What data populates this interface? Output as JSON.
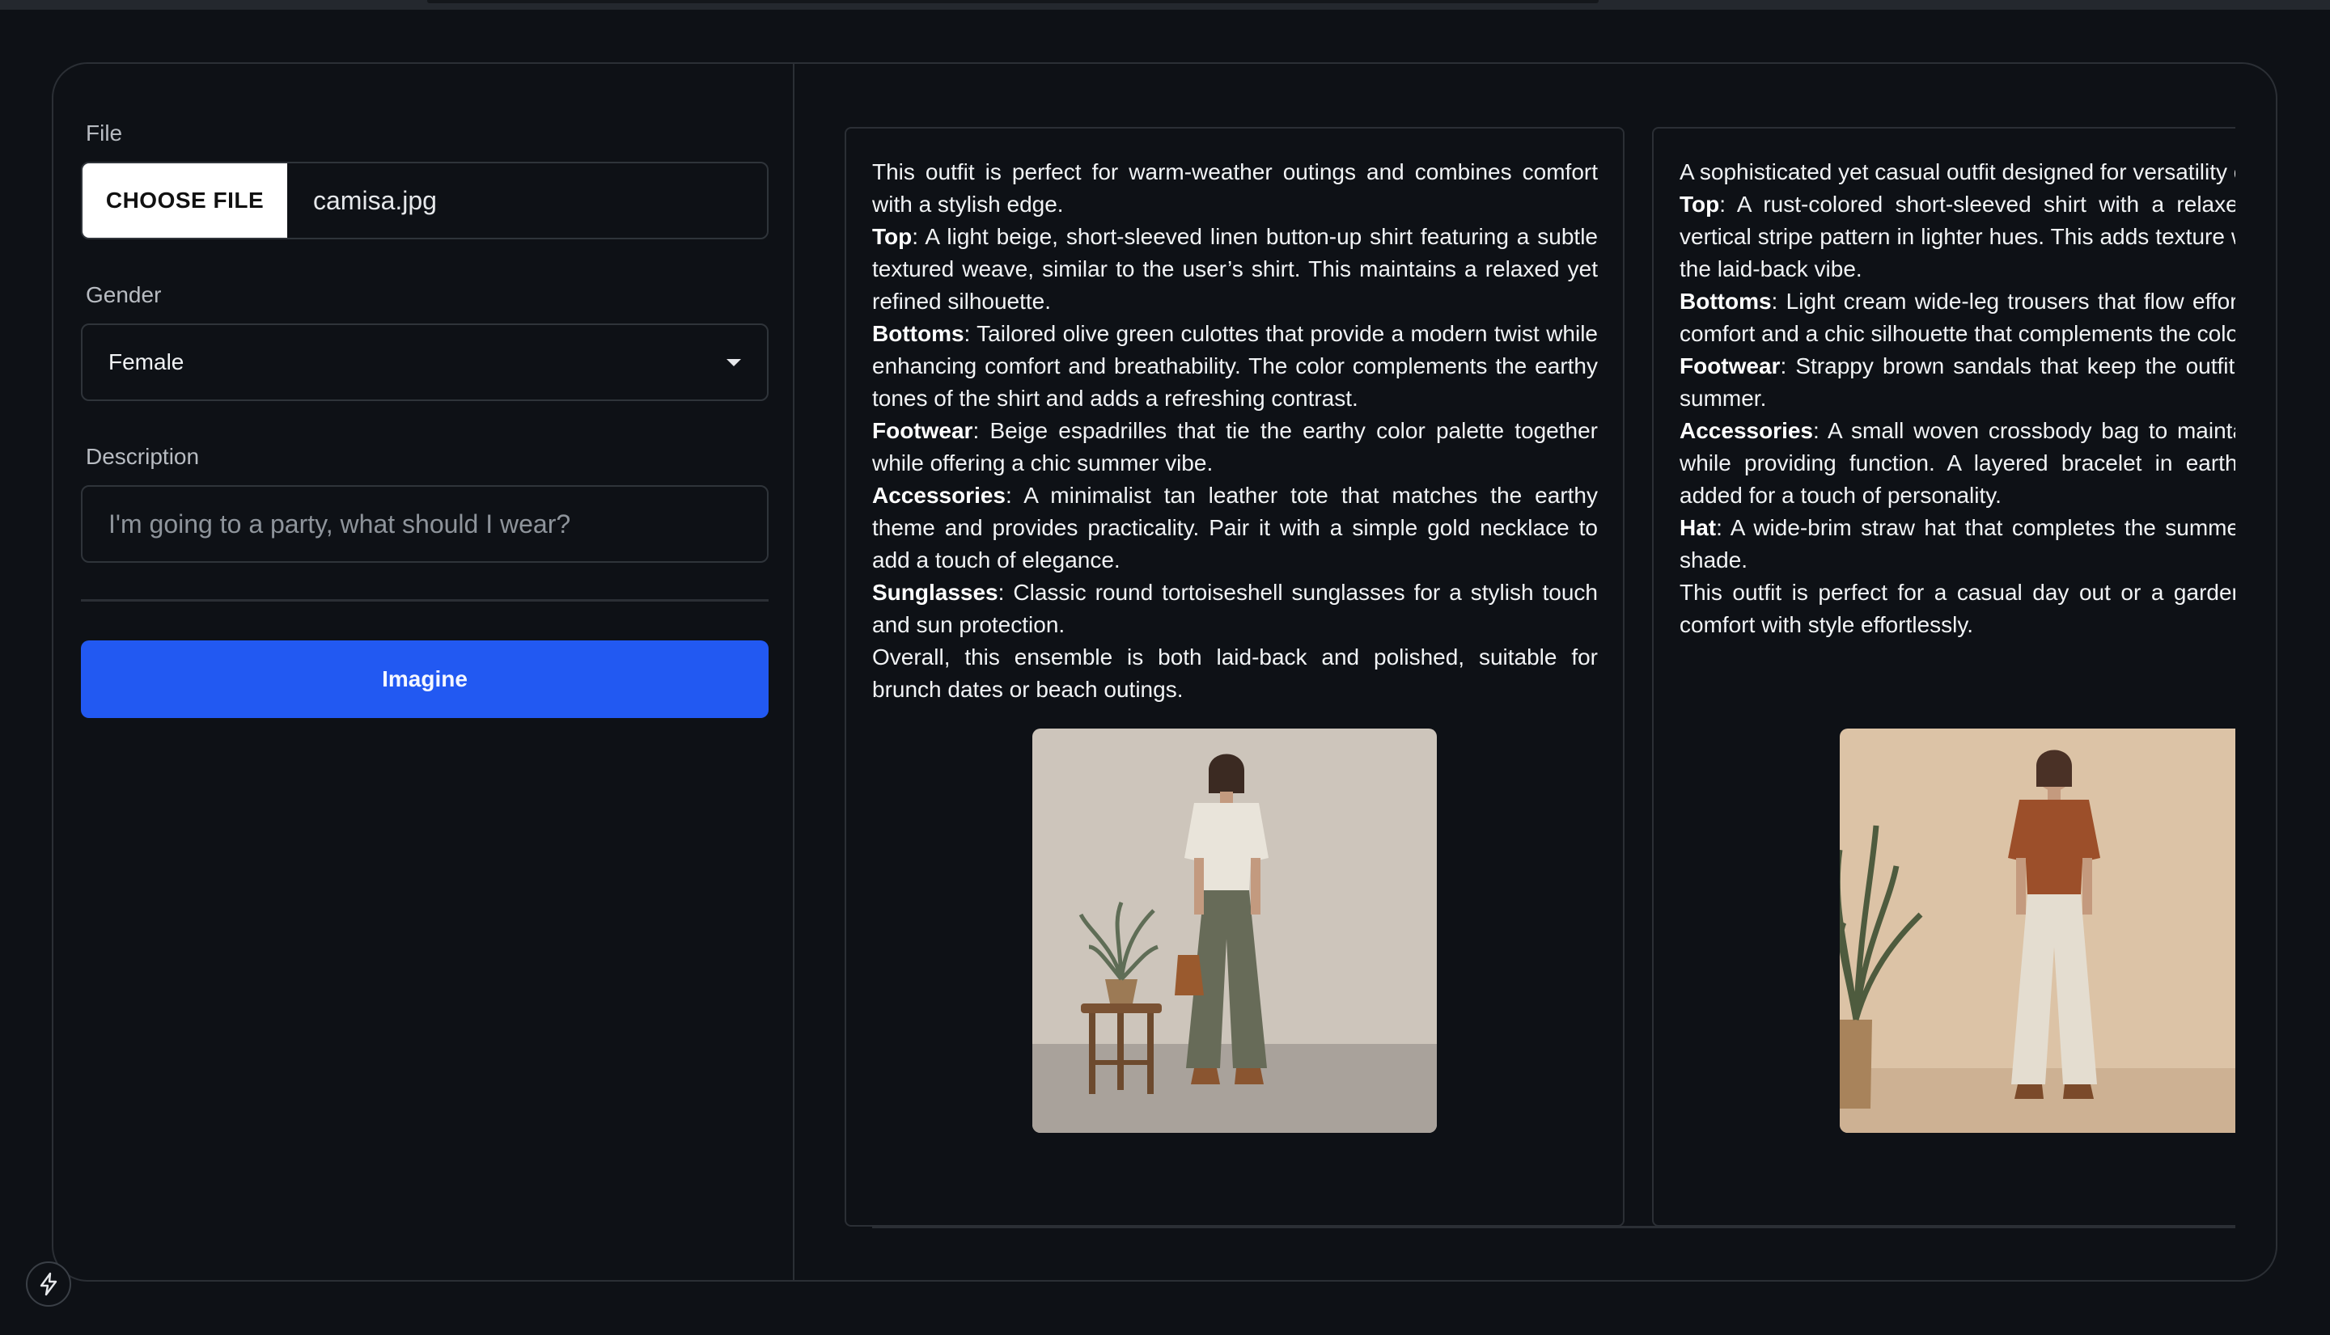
{
  "form": {
    "file_label": "File",
    "choose_file_label": "CHOOSE FILE",
    "file_name": "camisa.jpg",
    "gender_label": "Gender",
    "gender_value": "Female",
    "description_label": "Description",
    "description_placeholder": "I'm going to a party, what should I wear?",
    "submit_label": "Imagine"
  },
  "results": [
    {
      "intro": "This outfit is perfect for warm-weather outings and combines comfort with a stylish edge.",
      "items": [
        {
          "label": "Top",
          "text": ": A light beige, short-sleeved linen button-up shirt featuring a subtle textured weave, similar to the user’s shirt. This maintains a relaxed yet refined silhouette."
        },
        {
          "label": "Bottoms",
          "text": ": Tailored olive green culottes that provide a modern twist while enhancing comfort and breathability. The color complements the earthy tones of the shirt and adds a refreshing contrast."
        },
        {
          "label": "Footwear",
          "text": ": Beige espadrilles that tie the earthy color palette together while offering a chic summer vibe."
        },
        {
          "label": "Accessories",
          "text": ": A minimalist tan leather tote that matches the earthy theme and provides practicality. Pair it with a simple gold necklace to add a touch of elegance."
        },
        {
          "label": "Sunglasses",
          "text": ": Classic round tortoiseshell sunglasses for a stylish touch and sun protection."
        }
      ],
      "outro": "Overall, this ensemble is both laid-back and polished, suitable for brunch dates or beach outings."
    },
    {
      "intro": "A sophisticated yet casual outfit designed for versatility on warm days.",
      "items": [
        {
          "label": "Top",
          "text": ": A rust-colored short-sleeved shirt with a relaxed fit and a thin vertical stripe pattern in lighter hues. This adds texture while maintaining the laid-back vibe."
        },
        {
          "label": "Bottoms",
          "text": ": Light cream wide-leg trousers that flow effortlessly, providing comfort and a chic silhouette that complements the colors."
        },
        {
          "label": "Footwear",
          "text": ": Strappy brown sandals that keep the outfit cool, perfect for summer."
        },
        {
          "label": "Accessories",
          "text": ": A small woven crossbody bag to maintain the elegance while providing function. A layered bracelet in earthy tones can be added for a touch of personality."
        },
        {
          "label": "Hat",
          "text": ": A wide-brim straw hat that completes the summer look, providing shade."
        }
      ],
      "outro": "This outfit is perfect for a casual day out or a garden party, blending comfort with style effortlessly."
    }
  ],
  "colors": {
    "background": "#0e1116",
    "border": "#2b2f35",
    "primary_button": "#2259f2"
  },
  "icons": {
    "select_caret": "caret-down-icon",
    "floating_button": "bolt-icon"
  }
}
